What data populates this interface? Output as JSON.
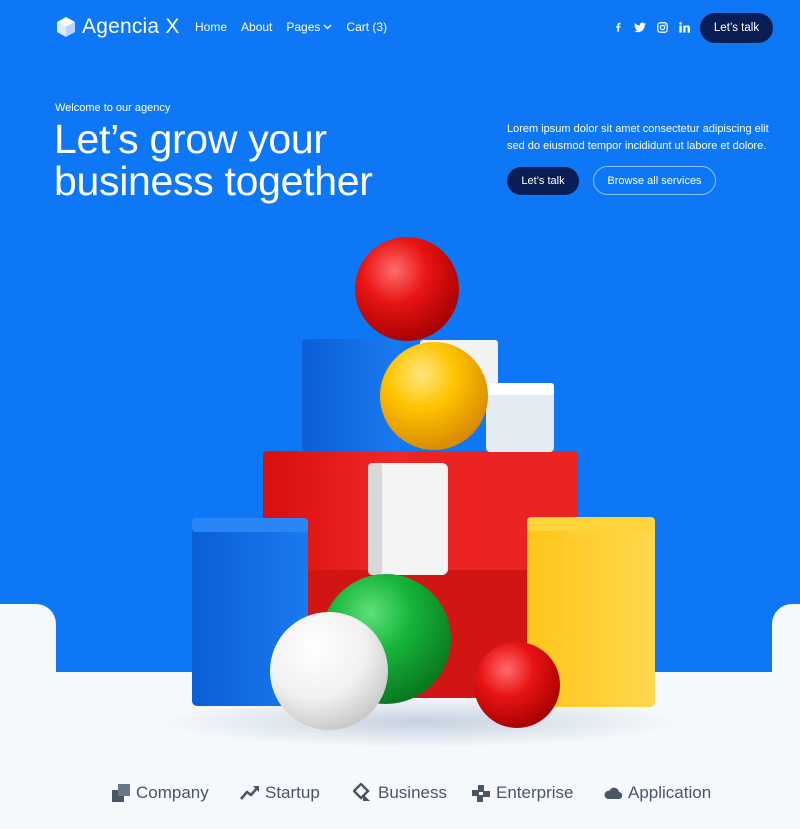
{
  "header": {
    "brand": "Agencia X",
    "nav": [
      {
        "label": "Home"
      },
      {
        "label": "About"
      },
      {
        "label": "Pages"
      },
      {
        "label": "Cart (3)"
      }
    ],
    "social_icons": [
      "facebook-icon",
      "twitter-icon",
      "instagram-icon",
      "linkedin-icon"
    ],
    "cta_label": "Let’s talk"
  },
  "hero": {
    "eyebrow": "Welcome to our agency",
    "headline_line1": "Let’s grow your",
    "headline_line2": "business together",
    "description": "Lorem ipsum dolor sit amet consectetur adipiscing elit sed do eiusmod tempor incididunt ut labore et dolore.",
    "primary_button": "Let’s talk",
    "secondary_button": "Browse all services"
  },
  "client_logos": [
    {
      "label": "Company",
      "icon": "company-logo-icon"
    },
    {
      "label": "Startup",
      "icon": "startup-logo-icon"
    },
    {
      "label": "Business",
      "icon": "business-logo-icon"
    },
    {
      "label": "Enterprise",
      "icon": "enterprise-logo-icon"
    },
    {
      "label": "Application",
      "icon": "application-logo-icon"
    }
  ],
  "colors": {
    "hero_blue": "#0d77f5",
    "dark_navy": "#0a1e55",
    "page_bg": "#f6f9fc",
    "logo_gray": "#4a5568"
  }
}
